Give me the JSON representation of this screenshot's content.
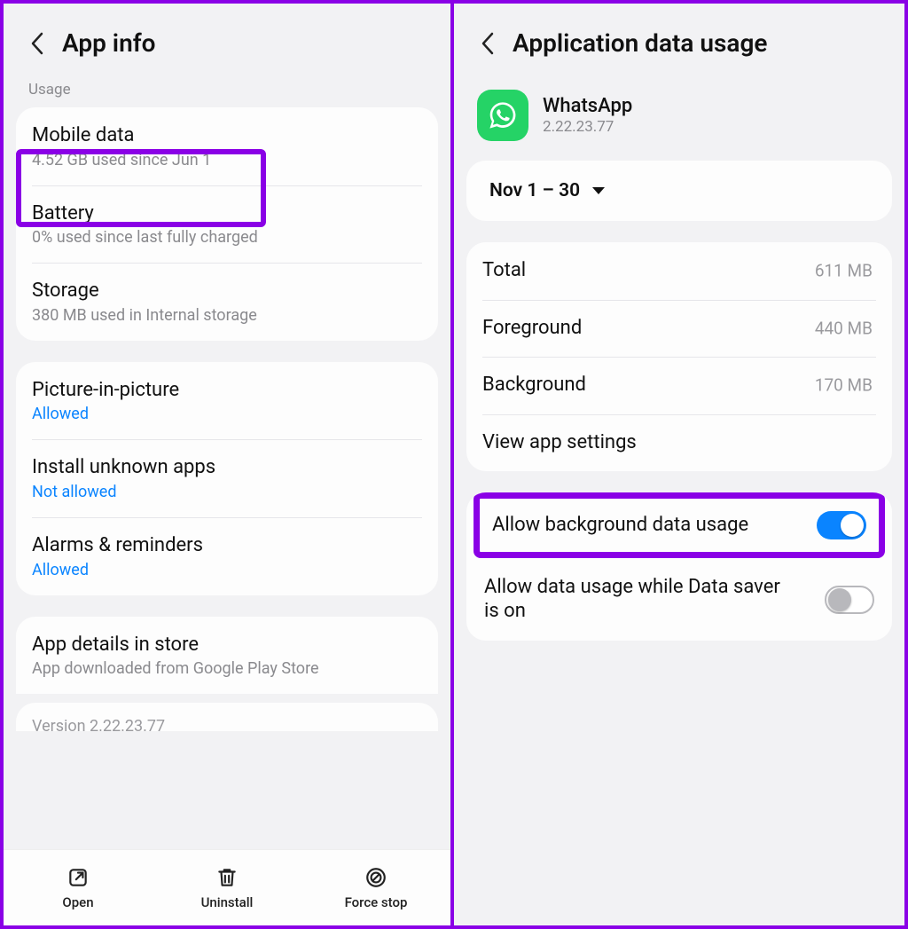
{
  "left": {
    "header_title": "App info",
    "section_usage": "Usage",
    "mobile_data": {
      "title": "Mobile data",
      "sub": "4.52 GB used since Jun 1"
    },
    "battery": {
      "title": "Battery",
      "sub": "0% used since last fully charged"
    },
    "storage": {
      "title": "Storage",
      "sub": "380 MB used in Internal storage"
    },
    "pip": {
      "title": "Picture-in-picture",
      "sub": "Allowed"
    },
    "unknown": {
      "title": "Install unknown apps",
      "sub": "Not allowed"
    },
    "alarms": {
      "title": "Alarms & reminders",
      "sub": "Allowed"
    },
    "store": {
      "title": "App details in store",
      "sub": "App downloaded from Google Play Store"
    },
    "version_peek": "Version 2.22.23.77",
    "toolbar": {
      "open": "Open",
      "uninstall": "Uninstall",
      "forcestop": "Force stop"
    }
  },
  "right": {
    "header_title": "Application data usage",
    "app_name": "WhatsApp",
    "app_version": "2.22.23.77",
    "date_range": "Nov 1 – 30",
    "total": {
      "label": "Total",
      "value": "611 MB"
    },
    "foreground": {
      "label": "Foreground",
      "value": "440 MB"
    },
    "background": {
      "label": "Background",
      "value": "170 MB"
    },
    "view_settings": "View app settings",
    "allow_bg": "Allow background data usage",
    "allow_saver": "Allow data usage while Data saver is on"
  }
}
